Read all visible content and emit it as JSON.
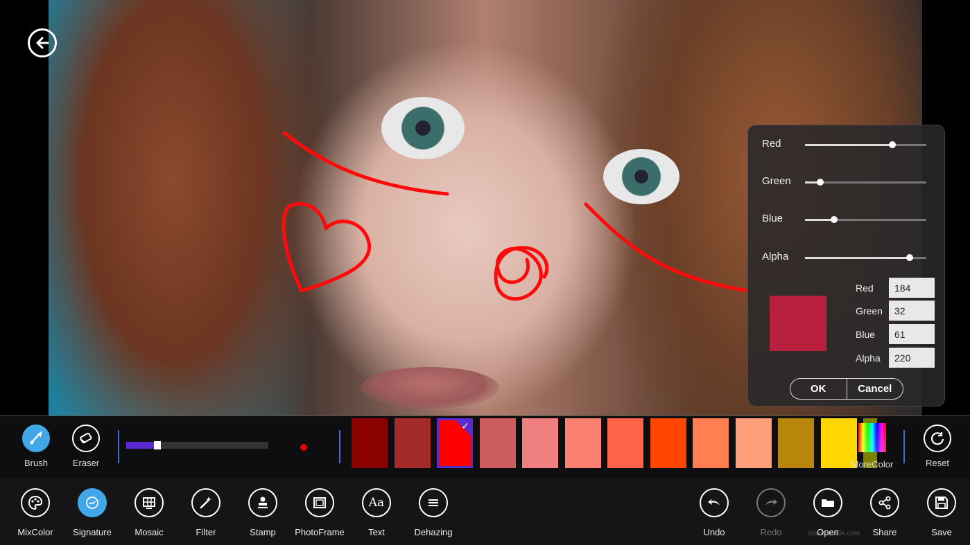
{
  "color_mixer": {
    "sliders": [
      {
        "label": "Red",
        "value": 184
      },
      {
        "label": "Green",
        "value": 32
      },
      {
        "label": "Blue",
        "value": 61
      },
      {
        "label": "Alpha",
        "value": 220
      }
    ],
    "fields": [
      {
        "label": "Red",
        "value": "184"
      },
      {
        "label": "Green",
        "value": "32"
      },
      {
        "label": "Blue",
        "value": "61"
      },
      {
        "label": "Alpha",
        "value": "220"
      }
    ],
    "preview_color": "#b8203d",
    "ok_label": "OK",
    "cancel_label": "Cancel"
  },
  "brush_strip": {
    "brush_label": "Brush",
    "eraser_label": "Eraser",
    "brush_size_fraction": 0.22,
    "brush_dot_color": "#e00000",
    "palette": [
      "#8b0000",
      "#a52a2a",
      "#ff0000",
      "#cd5c5c",
      "#f08080",
      "#fa8072",
      "#ff6347",
      "#ff4500",
      "#ff7f50",
      "#ffa07a",
      "#b8860b",
      "#ffd700",
      "#808000"
    ],
    "selected_index": 2,
    "more_color_label": "MoreColor",
    "reset_label": "Reset"
  },
  "toolbar": {
    "left": [
      {
        "label": "MixColor",
        "icon": "palette-icon"
      },
      {
        "label": "Signature",
        "icon": "signature-icon"
      },
      {
        "label": "Mosaic",
        "icon": "mosaic-icon"
      },
      {
        "label": "Filter",
        "icon": "magic-wand-icon"
      },
      {
        "label": "Stamp",
        "icon": "stamp-icon"
      },
      {
        "label": "PhotoFrame",
        "icon": "frame-icon"
      },
      {
        "label": "Text",
        "icon": "text-icon"
      },
      {
        "label": "Dehazing",
        "icon": "dehaze-icon"
      }
    ],
    "right": [
      {
        "label": "Undo",
        "icon": "undo-icon"
      },
      {
        "label": "Redo",
        "icon": "redo-icon"
      },
      {
        "label": "Open",
        "icon": "folder-icon"
      },
      {
        "label": "Share",
        "icon": "share-icon"
      },
      {
        "label": "Save",
        "icon": "save-icon"
      }
    ],
    "active": "Signature",
    "accent": "#41a7e8"
  },
  "watermark": "download3k.com"
}
